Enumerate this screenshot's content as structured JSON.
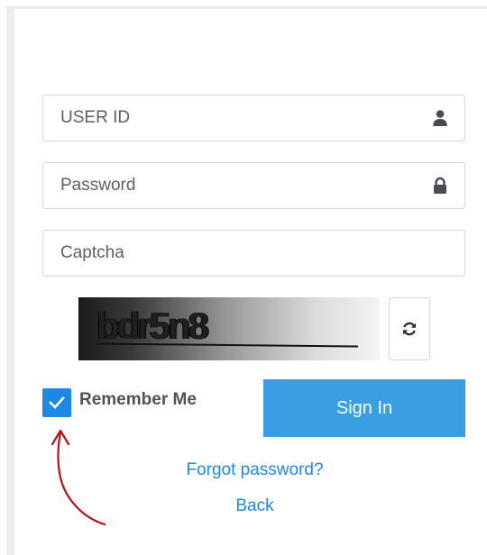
{
  "login_form": {
    "user_id": {
      "placeholder": "USER ID",
      "value": "",
      "icon": "user-icon"
    },
    "password": {
      "placeholder": "Password",
      "value": "",
      "icon": "lock-icon"
    },
    "captcha": {
      "placeholder": "Captcha",
      "value": ""
    },
    "captcha_image": {
      "text": "bdr5n8"
    },
    "refresh_button": {
      "icon": "refresh-icon"
    },
    "remember_me": {
      "label": "Remember Me",
      "checked": true
    },
    "sign_in_label": "Sign In",
    "forgot_password_label": "Forgot password?",
    "back_label": "Back"
  },
  "colors": {
    "accent": "#3a9ee3",
    "checkbox": "#1e88e5",
    "link": "#1e88e5",
    "annotation_arrow": "#b3141c"
  }
}
